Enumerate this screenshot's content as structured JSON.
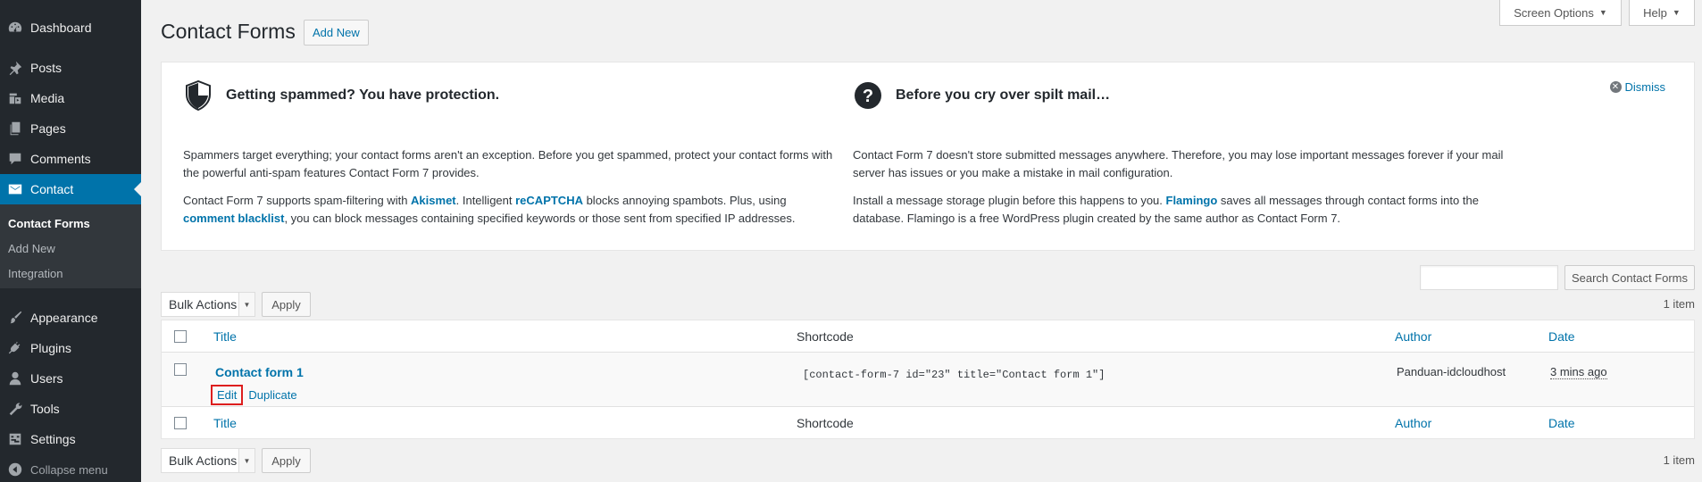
{
  "sidebar": {
    "items": [
      {
        "label": "Dashboard",
        "icon": "dashboard-icon"
      },
      {
        "label": "Posts",
        "icon": "pin-icon"
      },
      {
        "label": "Media",
        "icon": "media-icon"
      },
      {
        "label": "Pages",
        "icon": "pages-icon"
      },
      {
        "label": "Comments",
        "icon": "comment-icon"
      },
      {
        "label": "Contact",
        "icon": "mail-icon"
      },
      {
        "label": "Appearance",
        "icon": "paintbrush-icon"
      },
      {
        "label": "Plugins",
        "icon": "plugin-icon"
      },
      {
        "label": "Users",
        "icon": "user-icon"
      },
      {
        "label": "Tools",
        "icon": "wrench-icon"
      },
      {
        "label": "Settings",
        "icon": "settings-icon"
      }
    ],
    "submenu": [
      "Contact Forms",
      "Add New",
      "Integration"
    ],
    "collapse_label": "Collapse menu"
  },
  "top_tabs": {
    "screen_options": "Screen Options",
    "help": "Help"
  },
  "header": {
    "title": "Contact Forms",
    "add_new": "Add New"
  },
  "welcome": {
    "dismiss": "Dismiss",
    "left": {
      "title": "Getting spammed? You have protection.",
      "p1": "Spammers target everything; your contact forms aren't an exception. Before you get spammed, protect your contact forms with the powerful anti-spam features Contact Form 7 provides.",
      "p2_a": "Contact Form 7 supports spam-filtering with ",
      "p2_link1": "Akismet",
      "p2_b": ". Intelligent ",
      "p2_link2": "reCAPTCHA",
      "p2_c": " blocks annoying spambots. Plus, using ",
      "p2_link3": "comment blacklist",
      "p2_d": ", you can block messages containing specified keywords or those sent from specified IP addresses."
    },
    "right": {
      "title": "Before you cry over spilt mail…",
      "p1": "Contact Form 7 doesn't store submitted messages anywhere. Therefore, you may lose important messages forever if your mail server has issues or you make a mistake in mail configuration.",
      "p2_a": "Install a message storage plugin before this happens to you. ",
      "p2_link": "Flamingo",
      "p2_b": " saves all messages through contact forms into the database. Flamingo is a free WordPress plugin created by the same author as Contact Form 7."
    }
  },
  "search": {
    "placeholder": "",
    "button": "Search Contact Forms"
  },
  "bulk": {
    "label": "Bulk Actions",
    "apply": "Apply",
    "count": "1 item"
  },
  "table": {
    "columns": {
      "title": "Title",
      "shortcode": "Shortcode",
      "author": "Author",
      "date": "Date"
    },
    "rows": [
      {
        "title": "Contact form 1",
        "edit": "Edit",
        "duplicate": "Duplicate",
        "shortcode": "[contact-form-7 id=\"23\" title=\"Contact form 1\"]",
        "author": "Panduan-idcloudhost",
        "date": "3 mins ago"
      }
    ]
  },
  "colors": {
    "sidebar_bg": "#23282d",
    "active_bg": "#0073aa",
    "link": "#0073aa",
    "highlight": "#dd1e1e"
  }
}
